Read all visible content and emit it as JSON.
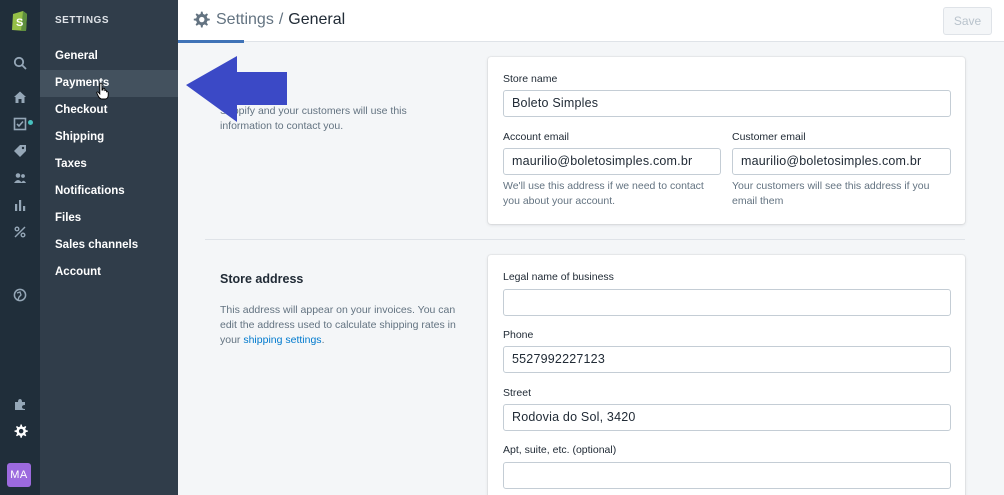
{
  "nav": {
    "heading": "SETTINGS",
    "items": [
      {
        "label": "General",
        "name": "general"
      },
      {
        "label": "Payments",
        "name": "payments"
      },
      {
        "label": "Checkout",
        "name": "checkout"
      },
      {
        "label": "Shipping",
        "name": "shipping"
      },
      {
        "label": "Taxes",
        "name": "taxes"
      },
      {
        "label": "Notifications",
        "name": "notifications"
      },
      {
        "label": "Files",
        "name": "files"
      },
      {
        "label": "Sales channels",
        "name": "sales-channels"
      },
      {
        "label": "Account",
        "name": "account"
      }
    ],
    "active_index": 1
  },
  "user": {
    "initials": "MA",
    "avatar_color": "#9c6ade"
  },
  "header": {
    "breadcrumb_parent": "Settings",
    "separator": "/",
    "title": "General",
    "save_label": "Save"
  },
  "store_details": {
    "description": "Shopify and your customers will use this information to contact you.",
    "store_name_label": "Store name",
    "store_name_value": "Boleto Simples",
    "account_email_label": "Account email",
    "account_email_value": "maurilio@boletosimples.com.br",
    "account_email_help": "We'll use this address if we need to contact you about your account.",
    "customer_email_label": "Customer email",
    "customer_email_value": "maurilio@boletosimples.com.br",
    "customer_email_help": "Your customers will see this address if you email them"
  },
  "store_address": {
    "title": "Store address",
    "description_prefix": "This address will appear on your invoices. You can edit the address used to calculate shipping rates in your ",
    "description_link": "shipping settings",
    "description_suffix": ".",
    "legal_name_label": "Legal name of business",
    "legal_name_value": "",
    "phone_label": "Phone",
    "phone_value": "5527992227123",
    "street_label": "Street",
    "street_value": "Rodovia do Sol, 3420",
    "apt_label": "Apt, suite, etc. (optional)",
    "apt_value": ""
  },
  "colors": {
    "accent": "#3f73b7",
    "arrow": "#3b49c6",
    "link": "#007ace"
  },
  "icons": [
    "shopify-logo-icon",
    "search-icon",
    "home-icon",
    "orders-icon",
    "tag-icon",
    "customers-icon",
    "analytics-icon",
    "discounts-icon",
    "globe-icon",
    "apps-icon",
    "gear-icon",
    "hand-cursor-icon",
    "arrow-left-icon"
  ]
}
